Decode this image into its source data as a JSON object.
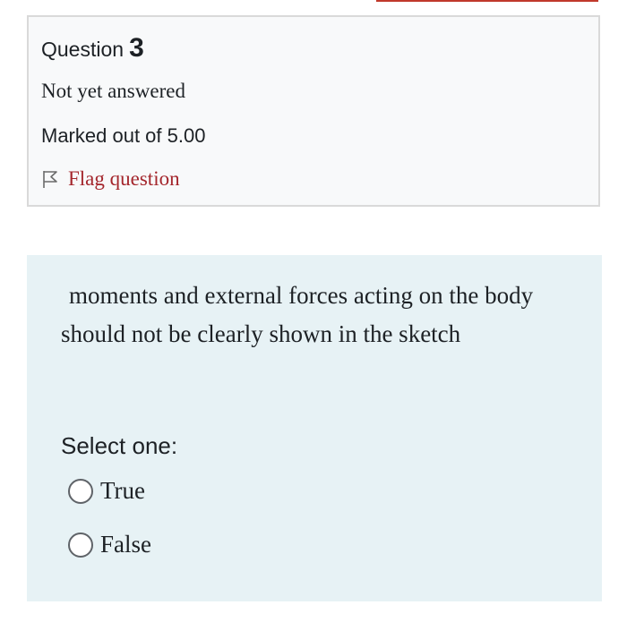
{
  "question_info": {
    "label": "Question",
    "number": "3",
    "state": "Not yet answered",
    "grade": "Marked out of 5.00",
    "flag_label": "Flag question",
    "flag_icon": "flag-outline-icon",
    "flag_color": "#a4262c"
  },
  "question": {
    "text": "moments and external forces  acting on the body should not be clearly shown in the sketch",
    "prompt": "Select one:",
    "options": [
      {
        "label": "True",
        "selected": false
      },
      {
        "label": "False",
        "selected": false
      }
    ]
  },
  "colors": {
    "info_background": "#f8f9fa",
    "content_background": "#e7f2f5",
    "accent_line": "#c0392b"
  }
}
